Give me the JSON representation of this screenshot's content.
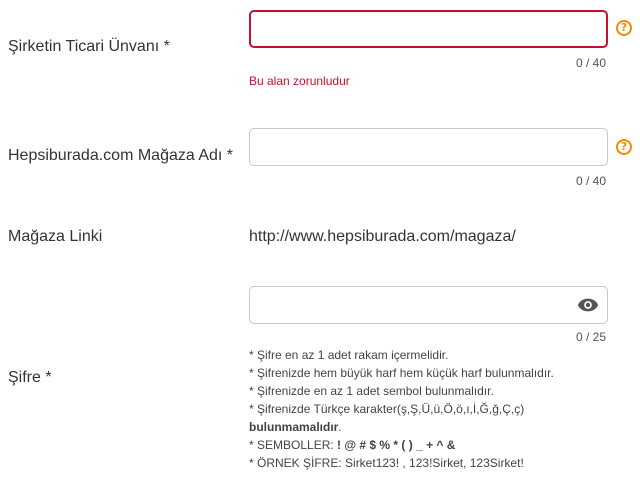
{
  "company_title": {
    "label": "Şirketin Ticari Ünvanı *",
    "value": "",
    "counter": "0 / 40",
    "error": "Bu alan zorunludur",
    "help_icon": "question-circle-icon"
  },
  "store_name": {
    "label": "Hepsiburada.com Mağaza Adı *",
    "value": "",
    "counter": "0 / 40",
    "help_icon": "question-circle-icon"
  },
  "store_link": {
    "label": "Mağaza Linki",
    "value": "http://www.hepsiburada.com/magaza/"
  },
  "password": {
    "label": "Şifre *",
    "value": "",
    "counter": "0 / 25",
    "toggle_icon": "eye-icon",
    "rules": {
      "r1": "* Şifre en az 1 adet rakam içermelidir.",
      "r2": "* Şifrenizde hem büyük harf hem küçük harf bulunmalıdır.",
      "r3": "* Şifrenizde en az 1 adet sembol bulunmalıdır.",
      "r4": "* Şifrenizde Türkçe karakter(ş,Ş,Ü,ü,Ö,ö,ı,İ,Ğ,ğ,Ç,ç)",
      "r4b": "bulunmamalıdır",
      "r4c": ".",
      "r5_prefix": "* SEMBOLLER: ",
      "r5_symbols": "! @ # $ % * ( ) _ + ^ &",
      "r6": "* ÖRNEK ŞİFRE: Sirket123! , 123!Sirket, 123Sirket!"
    }
  },
  "colors": {
    "error": "#c8102e",
    "help_accent": "#f28b00",
    "border": "#c8c8c8"
  }
}
